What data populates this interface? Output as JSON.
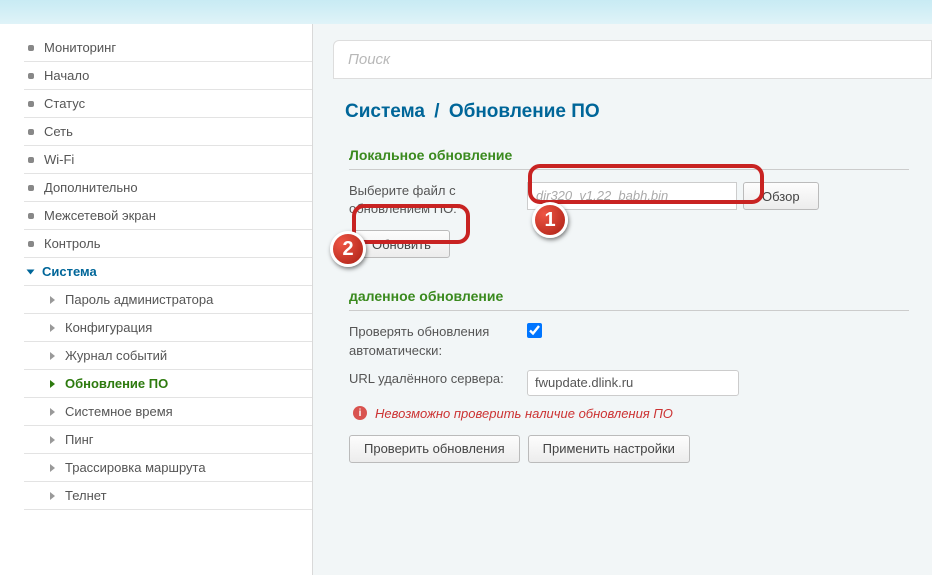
{
  "search": {
    "placeholder": "Поиск"
  },
  "breadcrumb": {
    "parent": "Система",
    "sep": "/",
    "current": "Обновление ПО"
  },
  "sidebar": {
    "items": [
      {
        "label": "Мониторинг"
      },
      {
        "label": "Начало"
      },
      {
        "label": "Статус"
      },
      {
        "label": "Сеть"
      },
      {
        "label": "Wi-Fi"
      },
      {
        "label": "Дополнительно"
      },
      {
        "label": "Межсетевой экран"
      },
      {
        "label": "Контроль"
      },
      {
        "label": "Система"
      }
    ],
    "subitems": [
      {
        "label": "Пароль администратора"
      },
      {
        "label": "Конфигурация"
      },
      {
        "label": "Журнал событий"
      },
      {
        "label": "Обновление ПО"
      },
      {
        "label": "Системное время"
      },
      {
        "label": "Пинг"
      },
      {
        "label": "Трассировка маршрута"
      },
      {
        "label": "Телнет"
      }
    ]
  },
  "local_update": {
    "title": "Локальное обновление",
    "file_label": "Выберите файл с обновлением ПО:",
    "file_value": "dir320_v1.22_babh.bin",
    "browse": "Обзор",
    "update": "Обновить"
  },
  "remote_update": {
    "title": "даленное обновление",
    "auto_check_label": "Проверять обновления автоматически:",
    "auto_check_value": true,
    "url_label": "URL удалённого сервера:",
    "url_value": "fwupdate.dlink.ru",
    "status": "Невозможно проверить наличие обновления ПО",
    "check_btn": "Проверить обновления",
    "apply_btn": "Применить настройки"
  },
  "callouts": {
    "one": "1",
    "two": "2"
  }
}
